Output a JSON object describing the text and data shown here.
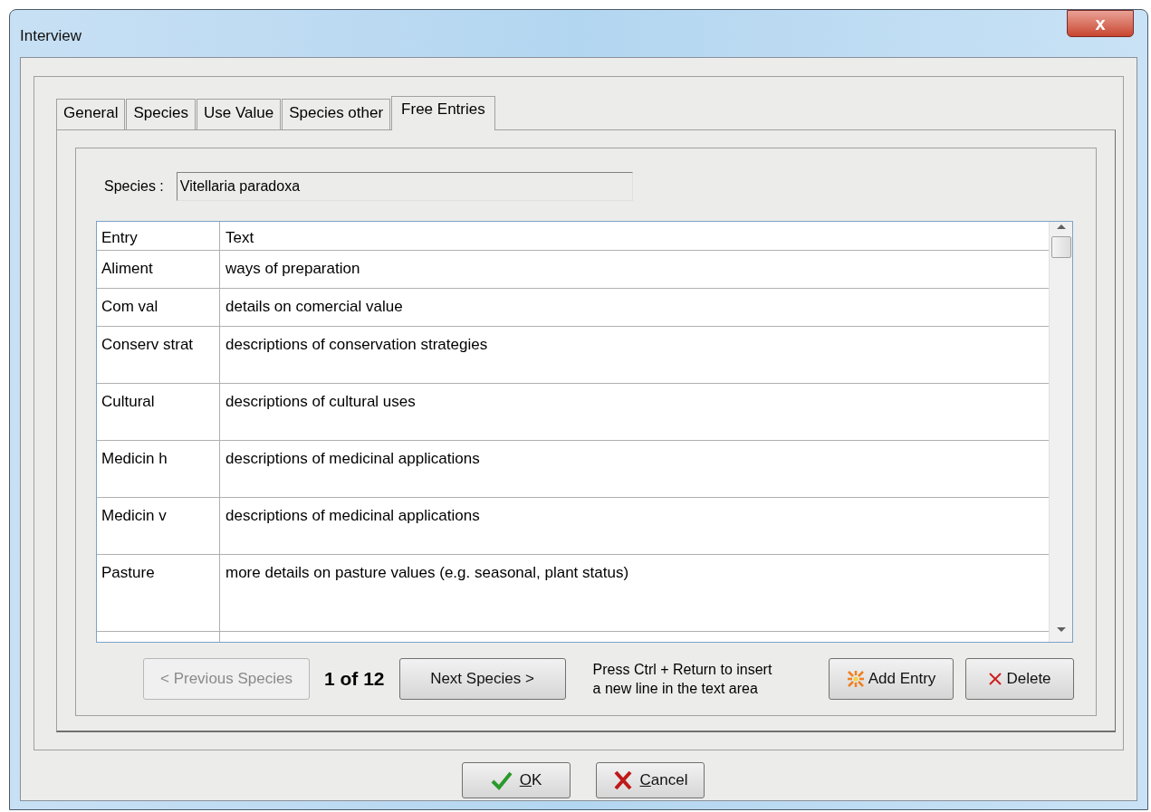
{
  "window": {
    "title": "Interview",
    "close_glyph": "x"
  },
  "tabs": [
    {
      "label": "General",
      "selected": false
    },
    {
      "label": "Species",
      "selected": false
    },
    {
      "label": "Use Value",
      "selected": false
    },
    {
      "label": "Species other",
      "selected": false
    },
    {
      "label": "Free Entries",
      "selected": true
    }
  ],
  "species_field": {
    "label": "Species :",
    "value": "Vitellaria paradoxa"
  },
  "table": {
    "columns": [
      "Entry",
      "Text"
    ],
    "rows": [
      {
        "entry": "Aliment",
        "text": "ways of preparation"
      },
      {
        "entry": "Com val",
        "text": "details on comercial value"
      },
      {
        "entry": "Conserv strat",
        "text": "descriptions of conservation strategies"
      },
      {
        "entry": "Cultural",
        "text": "descriptions of cultural uses"
      },
      {
        "entry": "Medicin h",
        "text": "descriptions of medicinal applications"
      },
      {
        "entry": "Medicin v",
        "text": "descriptions of medicinal applications"
      },
      {
        "entry": "Pasture",
        "text": "more details on pasture values (e.g. seasonal, plant status)"
      }
    ]
  },
  "navigation": {
    "previous": {
      "label": "< Previous Species",
      "disabled": true
    },
    "counter": "1 of 12",
    "next": {
      "label": "Next Species >",
      "disabled": false
    }
  },
  "hint": [
    "Press Ctrl + Return to insert",
    "a new line in the text area"
  ],
  "actions": [
    {
      "kind": "add",
      "label": "Add Entry"
    },
    {
      "kind": "delete",
      "label": "Delete"
    }
  ],
  "dialog_buttons": [
    {
      "kind": "ok",
      "label": "OK"
    },
    {
      "kind": "cancel",
      "label": "Cancel"
    }
  ]
}
